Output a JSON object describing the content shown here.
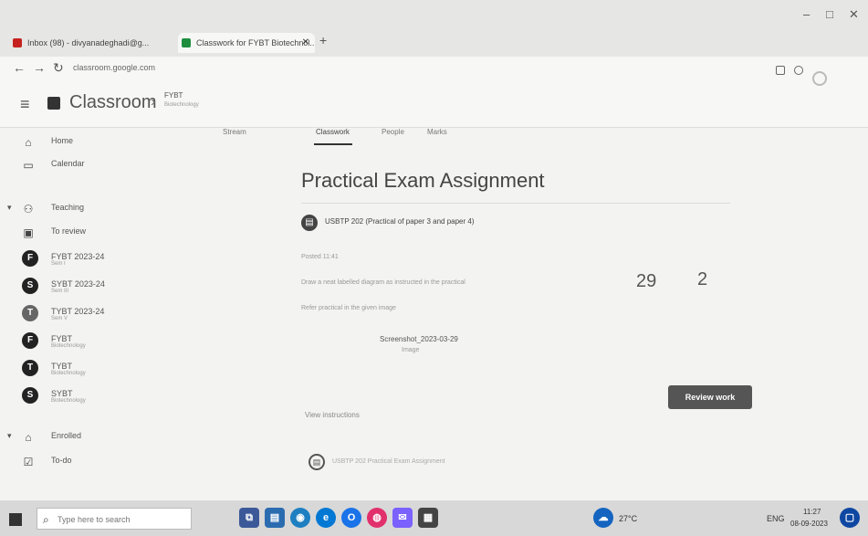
{
  "browser": {
    "tabs": [
      {
        "label": "Inbox (98) - divyanadeghadi@g...",
        "icon": "gmail-icon"
      },
      {
        "label": "Classwork for FYBT Biotechnol...",
        "icon": "classroom-icon"
      }
    ],
    "new_tab_label": "+",
    "url": "classroom.google.com"
  },
  "header": {
    "menu_icon": "hamburger-icon",
    "brand": "Classroom",
    "breadcrumb_sep": "›",
    "breadcrumb": "FYBT",
    "breadcrumb_sub": "Biotechnology"
  },
  "sidebar": {
    "items": [
      {
        "label": "Home",
        "icon": "home-icon"
      },
      {
        "label": "Calendar",
        "icon": "calendar-icon"
      },
      {
        "label": "Teaching",
        "icon": "people-icon",
        "expandable": true
      },
      {
        "label": "To review",
        "icon": "review-icon"
      },
      {
        "label": "FYBT 2023-24",
        "sub": "Sem I",
        "avatar": "F"
      },
      {
        "label": "SYBT 2023-24",
        "sub": "Sem III",
        "avatar": "S"
      },
      {
        "label": "TYBT 2023-24",
        "sub": "Sem V",
        "avatar": "T"
      },
      {
        "label": "FYBT",
        "sub": "Biotechnology",
        "avatar": "F"
      },
      {
        "label": "TYBT",
        "sub": "Biotechnology",
        "avatar": "T"
      },
      {
        "label": "SYBT",
        "sub": "Biotechnology",
        "avatar": "S"
      },
      {
        "label": "Enrolled",
        "icon": "graduation-cap-icon",
        "expandable": true
      },
      {
        "label": "To-do",
        "icon": "todo-icon"
      }
    ]
  },
  "content": {
    "tabs": [
      "Stream",
      "Classwork",
      "People",
      "Marks"
    ],
    "active_tab": "Classwork",
    "assignment_title": "Practical Exam Assignment",
    "course_line": "USBTP 202 (Practical of paper 3 and paper 4)",
    "posted_label": "Posted 11:41",
    "description": "Draw a neat labelled diagram as instructed in the practical",
    "instruction": "Refer practical in the given image",
    "num_turned_in": "29",
    "num_assigned": "2",
    "attachment_name": "Screenshot_2023-03-29",
    "attachment_type": "Image",
    "review_button": "Review work",
    "view_instructions": "View instructions",
    "next_assignment": "USBTP 202 Practical Exam Assignment"
  },
  "taskbar": {
    "search_placeholder": "Type here to search",
    "weather": "27°C",
    "lang": "ENG",
    "time": "11:27",
    "date": "08-09-2023"
  }
}
